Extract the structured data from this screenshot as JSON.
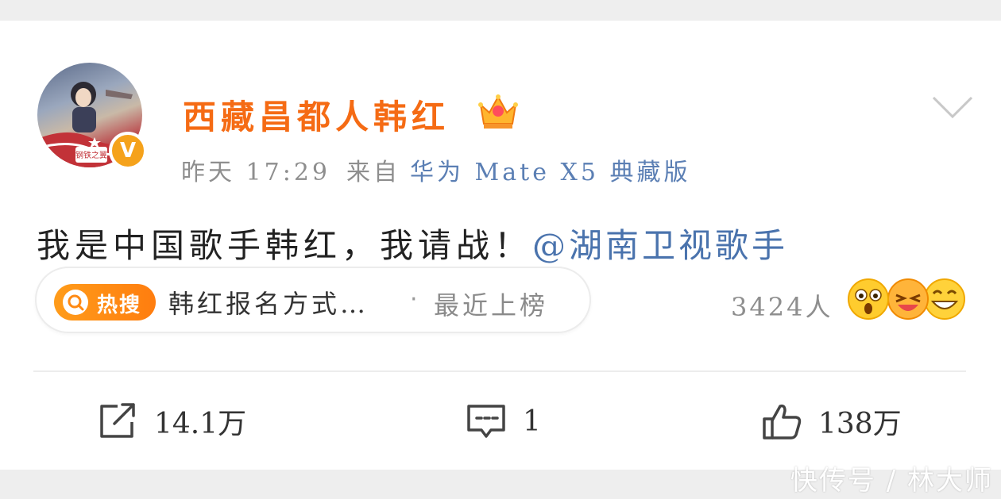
{
  "user": {
    "name": "西藏昌都人韩红",
    "verified_mark": "V",
    "avatar_badge_text": "钢铁之翼"
  },
  "meta": {
    "time": "昨天 17:29",
    "from_label": "来自",
    "device": "华为 Mate X5 典藏版"
  },
  "post": {
    "text": "我是中国歌手韩红，我请战！",
    "mention": "@湖南卫视歌手"
  },
  "hot_search": {
    "badge": "热搜",
    "topic": "韩红报名方式…",
    "separator": "·",
    "status": "最近上榜"
  },
  "reactions": {
    "count": "3424人",
    "icons": [
      "surprised-emoji-icon",
      "laugh-emoji-icon",
      "grin-emoji-icon"
    ]
  },
  "actions": {
    "share": "14.1万",
    "comment": "1",
    "like": "138万"
  },
  "watermark": "快传号 / 林大师",
  "colors": {
    "username": "#f56b14",
    "link": "#4a73ad",
    "hot_badge": "#ff8a14",
    "verified": "#f5a21b"
  }
}
